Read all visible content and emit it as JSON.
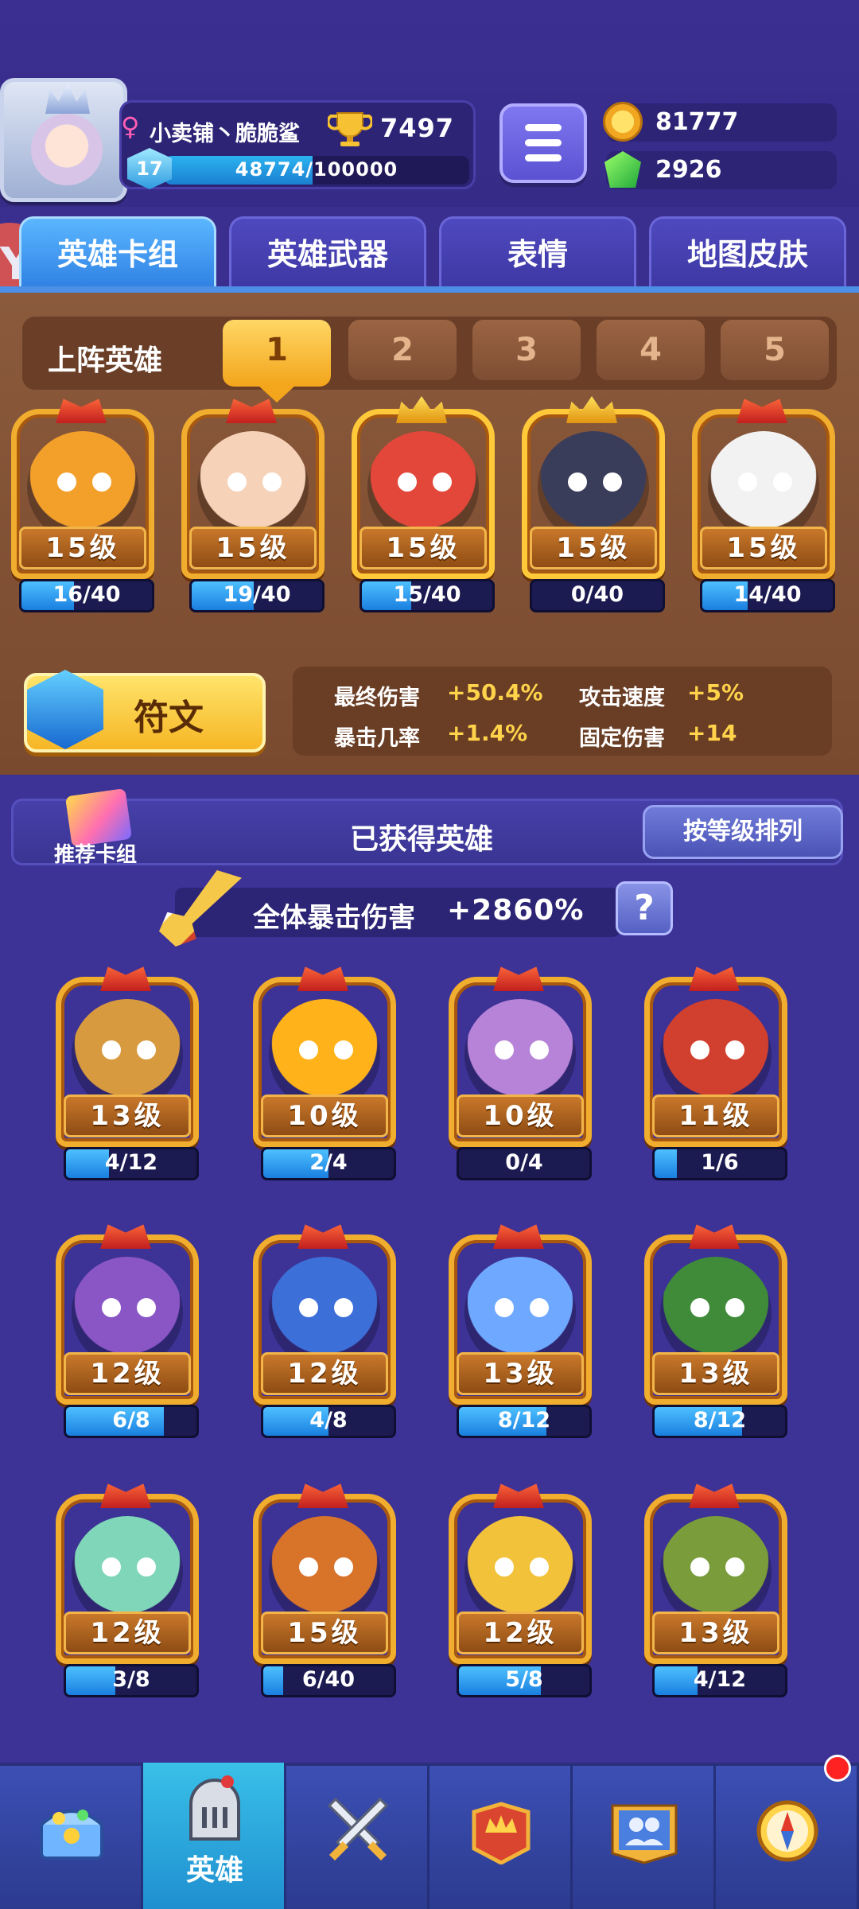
{
  "player": {
    "name": "小卖铺丶脆脆鲨",
    "trophies": "7497",
    "level": "17",
    "xp_text": "48774/100000",
    "xp_progress": 0.488
  },
  "currency": {
    "coins": "81777",
    "gems": "2926"
  },
  "tabs": [
    "英雄卡组",
    "英雄武器",
    "表情",
    "地图皮肤"
  ],
  "active_tab": 0,
  "lineup": {
    "title": "上阵英雄",
    "slots": [
      "1",
      "2",
      "3",
      "4",
      "5"
    ],
    "active_slot": 0,
    "heroes": [
      {
        "level": "15级",
        "count": "16/40",
        "progress": 0.4,
        "color": "#f3a02b",
        "crowned": false
      },
      {
        "level": "15级",
        "count": "19/40",
        "progress": 0.475,
        "color": "#f5d2b8",
        "crowned": false
      },
      {
        "level": "15级",
        "count": "15/40",
        "progress": 0.375,
        "color": "#e2473a",
        "crowned": true
      },
      {
        "level": "15级",
        "count": "0/40",
        "progress": 0.0,
        "color": "#3a3d5a",
        "crowned": true
      },
      {
        "level": "15级",
        "count": "14/40",
        "progress": 0.35,
        "color": "#f2f2f2",
        "crowned": false
      }
    ]
  },
  "rune": {
    "label": "符文",
    "stats": [
      {
        "label": "最终伤害",
        "value": "+50.4%"
      },
      {
        "label": "攻击速度",
        "value": "+5%"
      },
      {
        "label": "暴击几率",
        "value": "+1.4%"
      },
      {
        "label": "固定伤害",
        "value": "+14"
      }
    ]
  },
  "collection": {
    "deck_label": "推荐卡组",
    "title": "已获得英雄",
    "sort_label": "按等级排列",
    "crit_label": "全体暴击伤害",
    "crit_value": "+2860%",
    "help_label": "?",
    "heroes": [
      {
        "level": "13级",
        "count": "4/12",
        "progress": 0.33,
        "color": "#d89a3e"
      },
      {
        "level": "10级",
        "count": "2/4",
        "progress": 0.5,
        "color": "#ffb21a"
      },
      {
        "level": "10级",
        "count": "0/4",
        "progress": 0.0,
        "color": "#b783d8"
      },
      {
        "level": "11级",
        "count": "1/6",
        "progress": 0.17,
        "color": "#d1402f"
      },
      {
        "level": "12级",
        "count": "6/8",
        "progress": 0.75,
        "color": "#8a56c6"
      },
      {
        "level": "12级",
        "count": "4/8",
        "progress": 0.5,
        "color": "#3d6fd8"
      },
      {
        "level": "13级",
        "count": "8/12",
        "progress": 0.67,
        "color": "#6fa8ff"
      },
      {
        "level": "13级",
        "count": "8/12",
        "progress": 0.67,
        "color": "#3f8b3a"
      },
      {
        "level": "12级",
        "count": "3/8",
        "progress": 0.375,
        "color": "#7fd6b8"
      },
      {
        "level": "15级",
        "count": "6/40",
        "progress": 0.15,
        "color": "#d8732a"
      },
      {
        "level": "12级",
        "count": "5/8",
        "progress": 0.625,
        "color": "#f2c23a"
      },
      {
        "level": "13级",
        "count": "4/12",
        "progress": 0.33,
        "color": "#7a9c3a"
      }
    ]
  },
  "nav": {
    "items": [
      {
        "icon": "treasure-chest-icon",
        "label": ""
      },
      {
        "icon": "knight-helmet-icon",
        "label": "英雄"
      },
      {
        "icon": "crossed-swords-icon",
        "label": ""
      },
      {
        "icon": "crown-shield-icon",
        "label": ""
      },
      {
        "icon": "friends-icon",
        "label": ""
      },
      {
        "icon": "compass-icon",
        "label": ""
      }
    ],
    "active": 1
  },
  "side_badge": "Y"
}
